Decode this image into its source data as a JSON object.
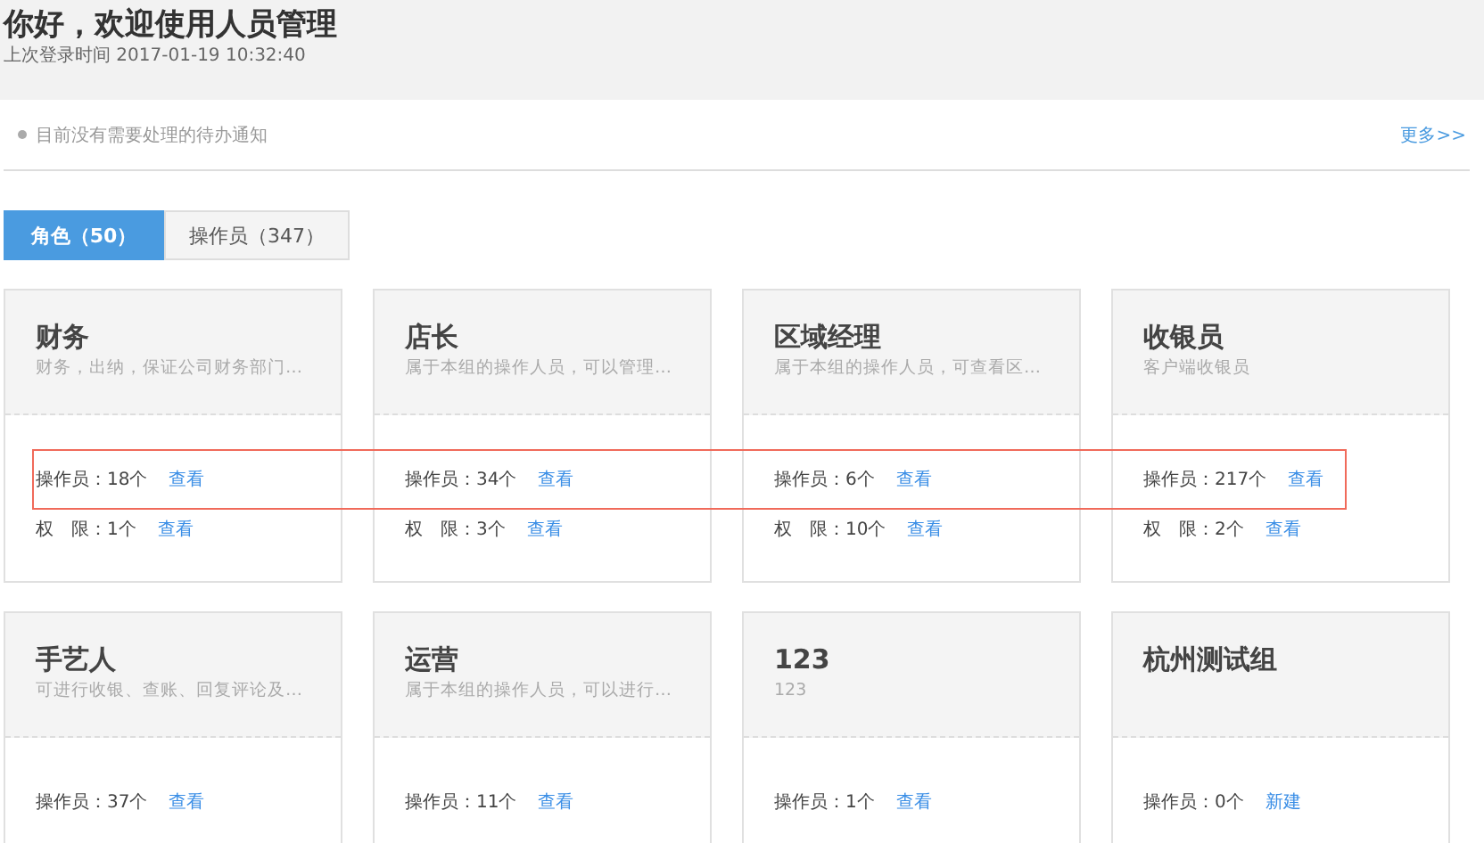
{
  "header": {
    "title": "你好，欢迎使用人员管理",
    "last_login": "上次登录时间 2017-01-19 10:32:40"
  },
  "notice": {
    "text": "目前没有需要处理的待办通知",
    "more": "更多>>"
  },
  "tabs": [
    {
      "label": "角色（50）",
      "selected": true
    },
    {
      "label": "操作员（347）",
      "selected": false
    }
  ],
  "cards": [
    {
      "title": "财务",
      "description": "财务，出纳，保证公司财务部门…",
      "rows": [
        {
          "text": "操作员：18个",
          "link": "查看"
        },
        {
          "text": "权　限：1个",
          "link": "查看"
        }
      ]
    },
    {
      "title": "店长",
      "description": "属于本组的操作人员，可以管理…",
      "rows": [
        {
          "text": "操作员：34个",
          "link": "查看"
        },
        {
          "text": "权　限：3个",
          "link": "查看"
        }
      ]
    },
    {
      "title": "区域经理",
      "description": "属于本组的操作人员，可查看区…",
      "rows": [
        {
          "text": "操作员：6个",
          "link": "查看"
        },
        {
          "text": "权　限：10个",
          "link": "查看"
        }
      ]
    },
    {
      "title": "收银员",
      "description": "客户端收银员",
      "rows": [
        {
          "text": "操作员：217个",
          "link": "查看"
        },
        {
          "text": "权　限：2个",
          "link": "查看"
        }
      ]
    },
    {
      "title": "手艺人",
      "description": "可进行收银、查账、回复评论及…",
      "rows": [
        {
          "text": "操作员：37个",
          "link": "查看"
        }
      ]
    },
    {
      "title": "运营",
      "description": "属于本组的操作人员，可以进行…",
      "rows": [
        {
          "text": "操作员：11个",
          "link": "查看"
        }
      ]
    },
    {
      "title": "123",
      "description": "123",
      "rows": [
        {
          "text": "操作员：1个",
          "link": "查看"
        }
      ]
    },
    {
      "title": "杭州测试组",
      "rows": [
        {
          "text": "操作员：0个",
          "link": "新建"
        }
      ]
    }
  ],
  "annotation": {
    "kind": "frame"
  }
}
